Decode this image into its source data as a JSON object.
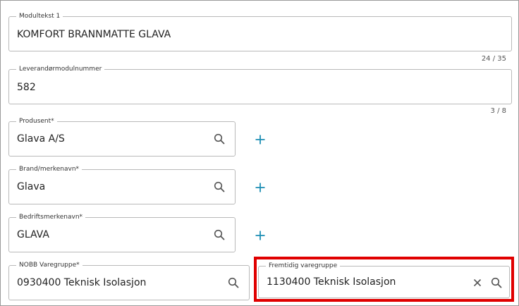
{
  "fields": [
    {
      "label": "Modultekst 1",
      "value": "KOMFORT BRANNMATTE GLAVA",
      "counter": "24 / 35"
    },
    {
      "label": "Leverandørmodulnummer",
      "value": "582",
      "counter": "3 / 8"
    },
    {
      "label": "Produsent*",
      "value": "Glava A/S"
    },
    {
      "label": "Brand/merkenavn*",
      "value": "Glava"
    },
    {
      "label": "Bedriftsmerkenavn*",
      "value": "GLAVA"
    },
    {
      "label": "NOBB Varegruppe*",
      "value": "0930400 Teknisk Isolasjon"
    },
    {
      "label": "Fremtidig varegruppe",
      "value": "1130400 Teknisk Isolasjon"
    }
  ],
  "icons": {
    "search": "search-icon",
    "add": "plus-icon",
    "clear": "close-icon"
  },
  "colors": {
    "accent": "#1f8fb5",
    "highlight": "#e00000",
    "border": "#b9b9b9"
  }
}
